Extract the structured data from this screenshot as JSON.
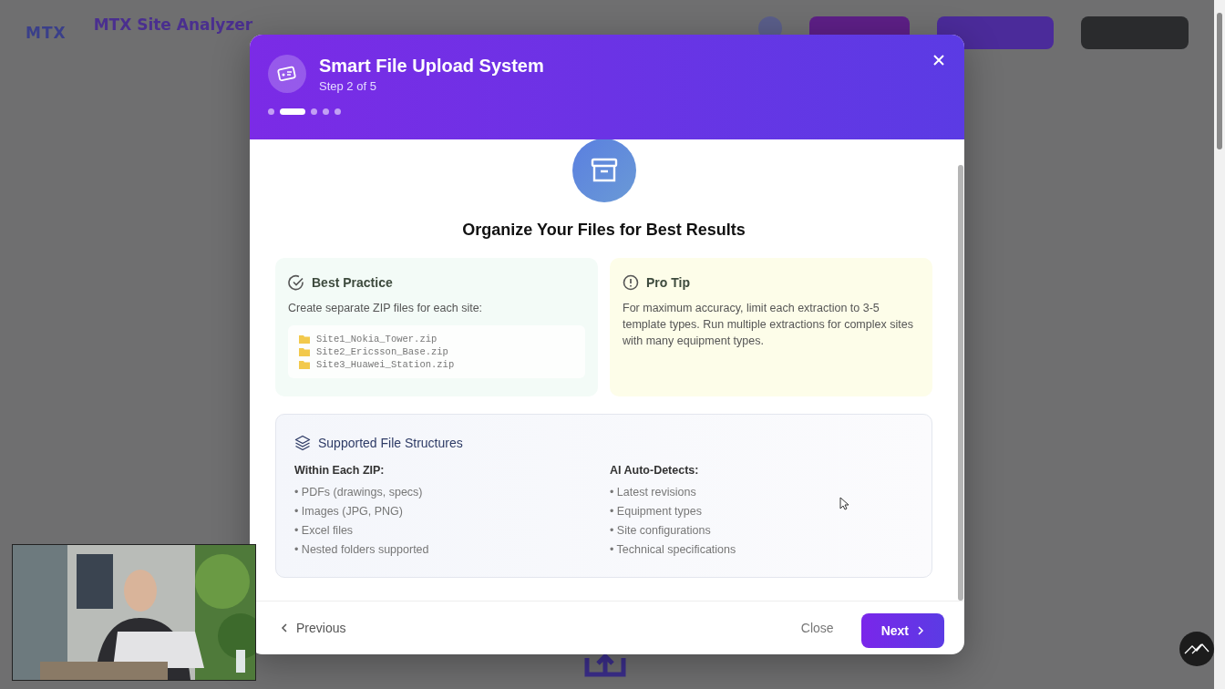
{
  "app": {
    "logo": "MTX",
    "title": "MTX Site Analyzer"
  },
  "modal": {
    "title": "Smart File Upload System",
    "step_label": "Step 2 of 5",
    "steps": [
      {
        "selected": false
      },
      {
        "selected": true
      },
      {
        "selected": false
      },
      {
        "selected": false
      },
      {
        "selected": false
      }
    ],
    "heading": "Organize Your Files for Best Results",
    "best_practice": {
      "title": "Best Practice",
      "text": "Create separate ZIP files for each site:",
      "files": [
        "Site1_Nokia_Tower.zip",
        "Site2_Ericsson_Base.zip",
        "Site3_Huawei_Station.zip"
      ]
    },
    "pro_tip": {
      "title": "Pro Tip",
      "text": "For maximum accuracy, limit each extraction to 3-5 template types. Run multiple extractions for complex sites with many equipment types."
    },
    "structures": {
      "title": "Supported File Structures",
      "columns": [
        {
          "heading": "Within Each ZIP:",
          "items": [
            "• PDFs (drawings, specs)",
            "• Images (JPG, PNG)",
            "• Excel files",
            "• Nested folders supported"
          ]
        },
        {
          "heading": "AI Auto-Detects:",
          "items": [
            "• Latest revisions",
            "• Equipment types",
            "• Site configurations",
            "• Technical specifications"
          ]
        }
      ]
    },
    "footer": {
      "previous": "Previous",
      "close": "Close",
      "next": "Next"
    }
  }
}
